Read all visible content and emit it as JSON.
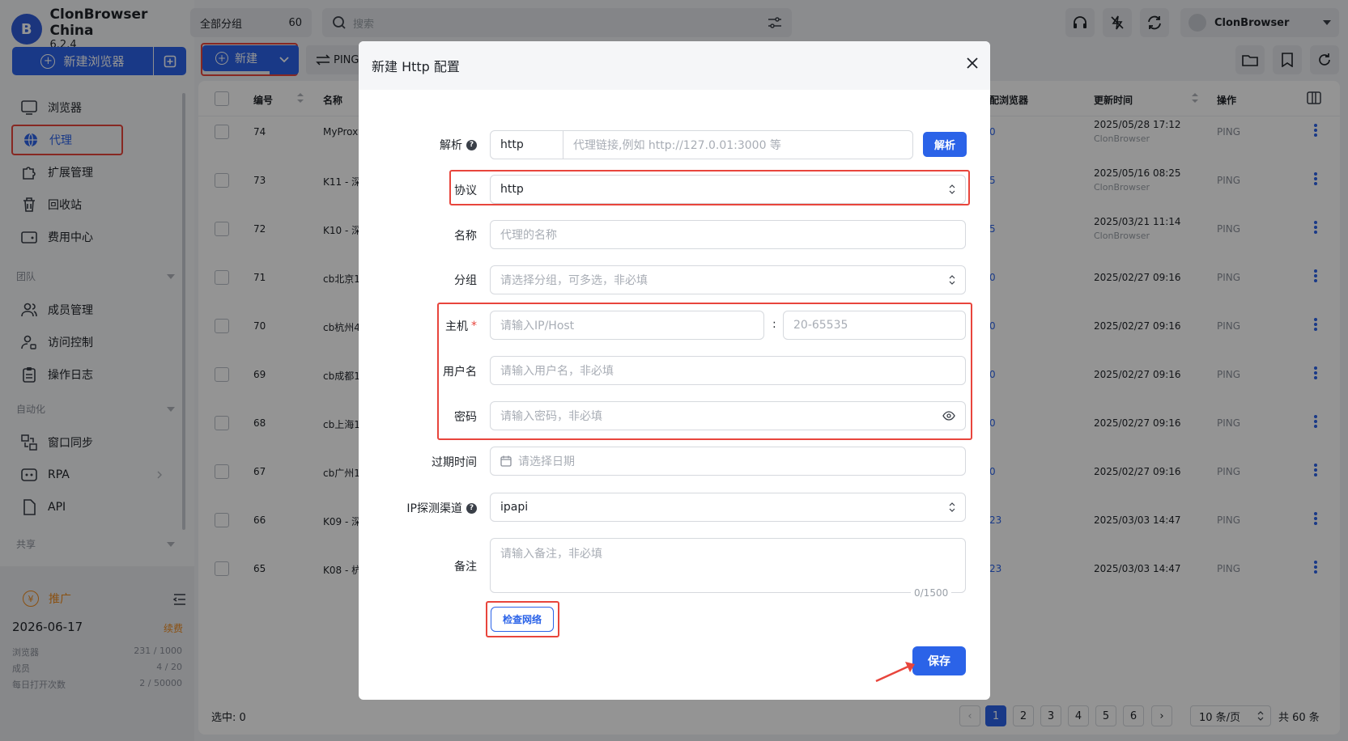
{
  "app": {
    "name": "ClonBrowser China",
    "version": "6.2.4",
    "logo_letter": "B"
  },
  "sidebar": {
    "new_browser_label": "新建浏览器",
    "items": [
      {
        "label": "浏览器",
        "icon": "browser-icon"
      },
      {
        "label": "代理",
        "icon": "globe-icon"
      },
      {
        "label": "扩展管理",
        "icon": "puzzle-icon"
      },
      {
        "label": "回收站",
        "icon": "trash-icon"
      },
      {
        "label": "费用中心",
        "icon": "wallet-icon"
      }
    ],
    "section_team": "团队",
    "team_items": [
      {
        "label": "成员管理",
        "icon": "users-icon"
      },
      {
        "label": "访问控制",
        "icon": "user-lock-icon"
      },
      {
        "label": "操作日志",
        "icon": "clipboard-icon"
      }
    ],
    "section_auto": "自动化",
    "auto_items": [
      {
        "label": "窗口同步",
        "icon": "sync-window-icon"
      },
      {
        "label": "RPA",
        "icon": "rpa-icon"
      },
      {
        "label": "API",
        "icon": "api-icon"
      }
    ],
    "section_share": "共享",
    "promo_label": "推广",
    "expire_date": "2026-06-17",
    "renew_label": "续费",
    "stats": [
      {
        "label": "浏览器",
        "value": "231 / 1000"
      },
      {
        "label": "成员",
        "value": "4 / 20"
      },
      {
        "label": "每日打开次数",
        "value": "2 / 50000"
      }
    ]
  },
  "topbar": {
    "group_label": "全部分组",
    "group_count": "60",
    "search_placeholder": "搜索",
    "user_name": "ClonBrowser"
  },
  "toolbar": {
    "new_label": "新建",
    "ping_label": "PING"
  },
  "table": {
    "columns": {
      "id": "编号",
      "name": "名称",
      "linked": "配浏览器",
      "updated": "更新时间",
      "action": "操作"
    },
    "rows": [
      {
        "id": "74",
        "name": "MyProxy",
        "linked": "0",
        "updated": "2025/05/28 17:12",
        "by": "ClonBrowser",
        "action": "PING"
      },
      {
        "id": "73",
        "name": "K11 - 深",
        "linked": "5",
        "updated": "2025/05/16 08:25",
        "by": "ClonBrowser",
        "action": "PING"
      },
      {
        "id": "72",
        "name": "K10 - 深",
        "linked": "5",
        "updated": "2025/03/21 11:14",
        "by": "ClonBrowser",
        "action": "PING"
      },
      {
        "id": "71",
        "name": "cb北京1",
        "linked": "0",
        "updated": "2025/02/27 09:16",
        "by": "",
        "action": "PING"
      },
      {
        "id": "70",
        "name": "cb杭州4",
        "linked": "0",
        "updated": "2025/02/27 09:16",
        "by": "",
        "action": "PING"
      },
      {
        "id": "69",
        "name": "cb成都1",
        "linked": "0",
        "updated": "2025/02/27 09:16",
        "by": "",
        "action": "PING"
      },
      {
        "id": "68",
        "name": "cb上海1",
        "linked": "0",
        "updated": "2025/02/27 09:16",
        "by": "",
        "action": "PING"
      },
      {
        "id": "67",
        "name": "cb广州1",
        "linked": "0",
        "updated": "2025/02/27 09:16",
        "by": "",
        "action": "PING"
      },
      {
        "id": "66",
        "name": "K09 - 深",
        "linked": "23",
        "updated": "2025/03/03 14:47",
        "by": "",
        "action": "PING"
      },
      {
        "id": "65",
        "name": "K08 - 杭",
        "linked": "23",
        "updated": "2025/03/03 14:47",
        "by": "",
        "action": "PING"
      }
    ],
    "selected_label": "选中: 0",
    "pages": [
      "1",
      "2",
      "3",
      "4",
      "5",
      "6"
    ],
    "page_size": "10 条/页",
    "total": "共 60 条"
  },
  "modal": {
    "title": "新建 Http 配置",
    "fields": {
      "parse": {
        "label": "解析",
        "scheme": "http",
        "placeholder": "代理链接,例如 http://127.0.01:3000 等",
        "button": "解析"
      },
      "protocol": {
        "label": "协议",
        "value": "http"
      },
      "name": {
        "label": "名称",
        "placeholder": "代理的名称"
      },
      "group": {
        "label": "分组",
        "placeholder": "请选择分组，可多选，非必填"
      },
      "host": {
        "label": "主机",
        "required": "*",
        "placeholder": "请输入IP/Host",
        "separator": ":",
        "port_placeholder": "20-65535"
      },
      "username": {
        "label": "用户名",
        "placeholder": "请输入用户名，非必填"
      },
      "password": {
        "label": "密码",
        "placeholder": "请输入密码，非必填"
      },
      "expire": {
        "label": "过期时间",
        "placeholder": "请选择日期"
      },
      "ip_channel": {
        "label": "IP探测渠道",
        "value": "ipapi"
      },
      "note": {
        "label": "备注",
        "placeholder": "请输入备注，非必填",
        "counter": "0/1500"
      }
    },
    "check_network": "检查网络",
    "save": "保存"
  },
  "colors": {
    "primary": "#2b63e8",
    "highlight": "#e8453c",
    "warning": "#ee8a1d"
  }
}
